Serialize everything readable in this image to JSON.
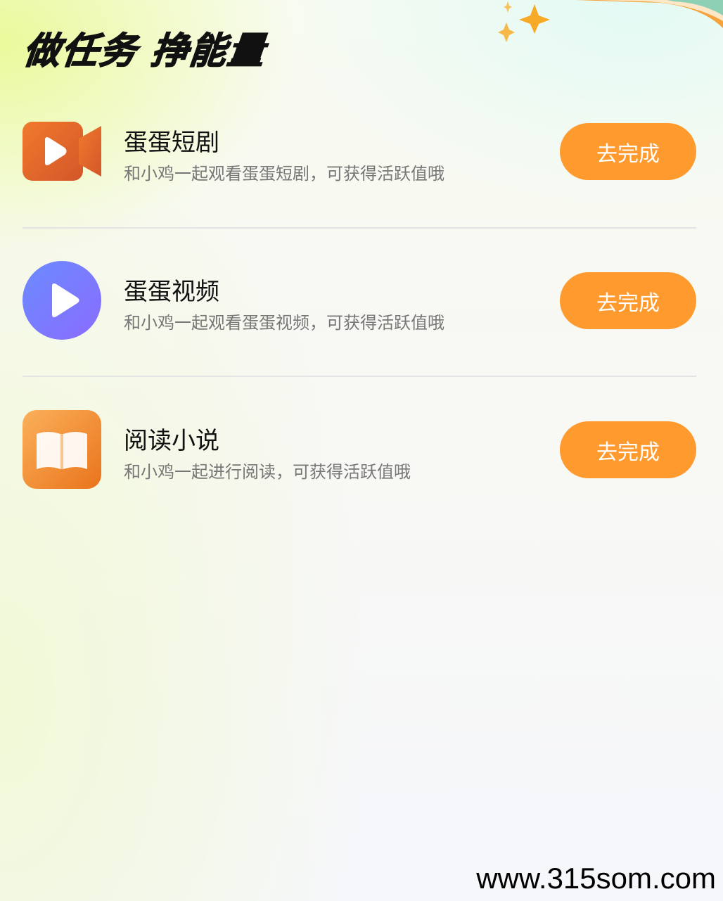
{
  "header": {
    "title": "做任务 挣能量"
  },
  "tasks": [
    {
      "title": "蛋蛋短剧",
      "desc": "和小鸡一起观看蛋蛋短剧，可获得活跃值哦",
      "button": "去完成",
      "icon": "video-camera-icon"
    },
    {
      "title": "蛋蛋视频",
      "desc": "和小鸡一起观看蛋蛋视频，可获得活跃值哦",
      "button": "去完成",
      "icon": "play-icon"
    },
    {
      "title": "阅读小说",
      "desc": "和小鸡一起进行阅读，可获得活跃值哦",
      "button": "去完成",
      "icon": "book-icon"
    }
  ],
  "colors": {
    "button": "#ff9a2e",
    "video_icon": "#e06a2a",
    "play_icon": "#7b7cff",
    "book_icon": "#f08a2a"
  },
  "watermark": "www.315som.com"
}
